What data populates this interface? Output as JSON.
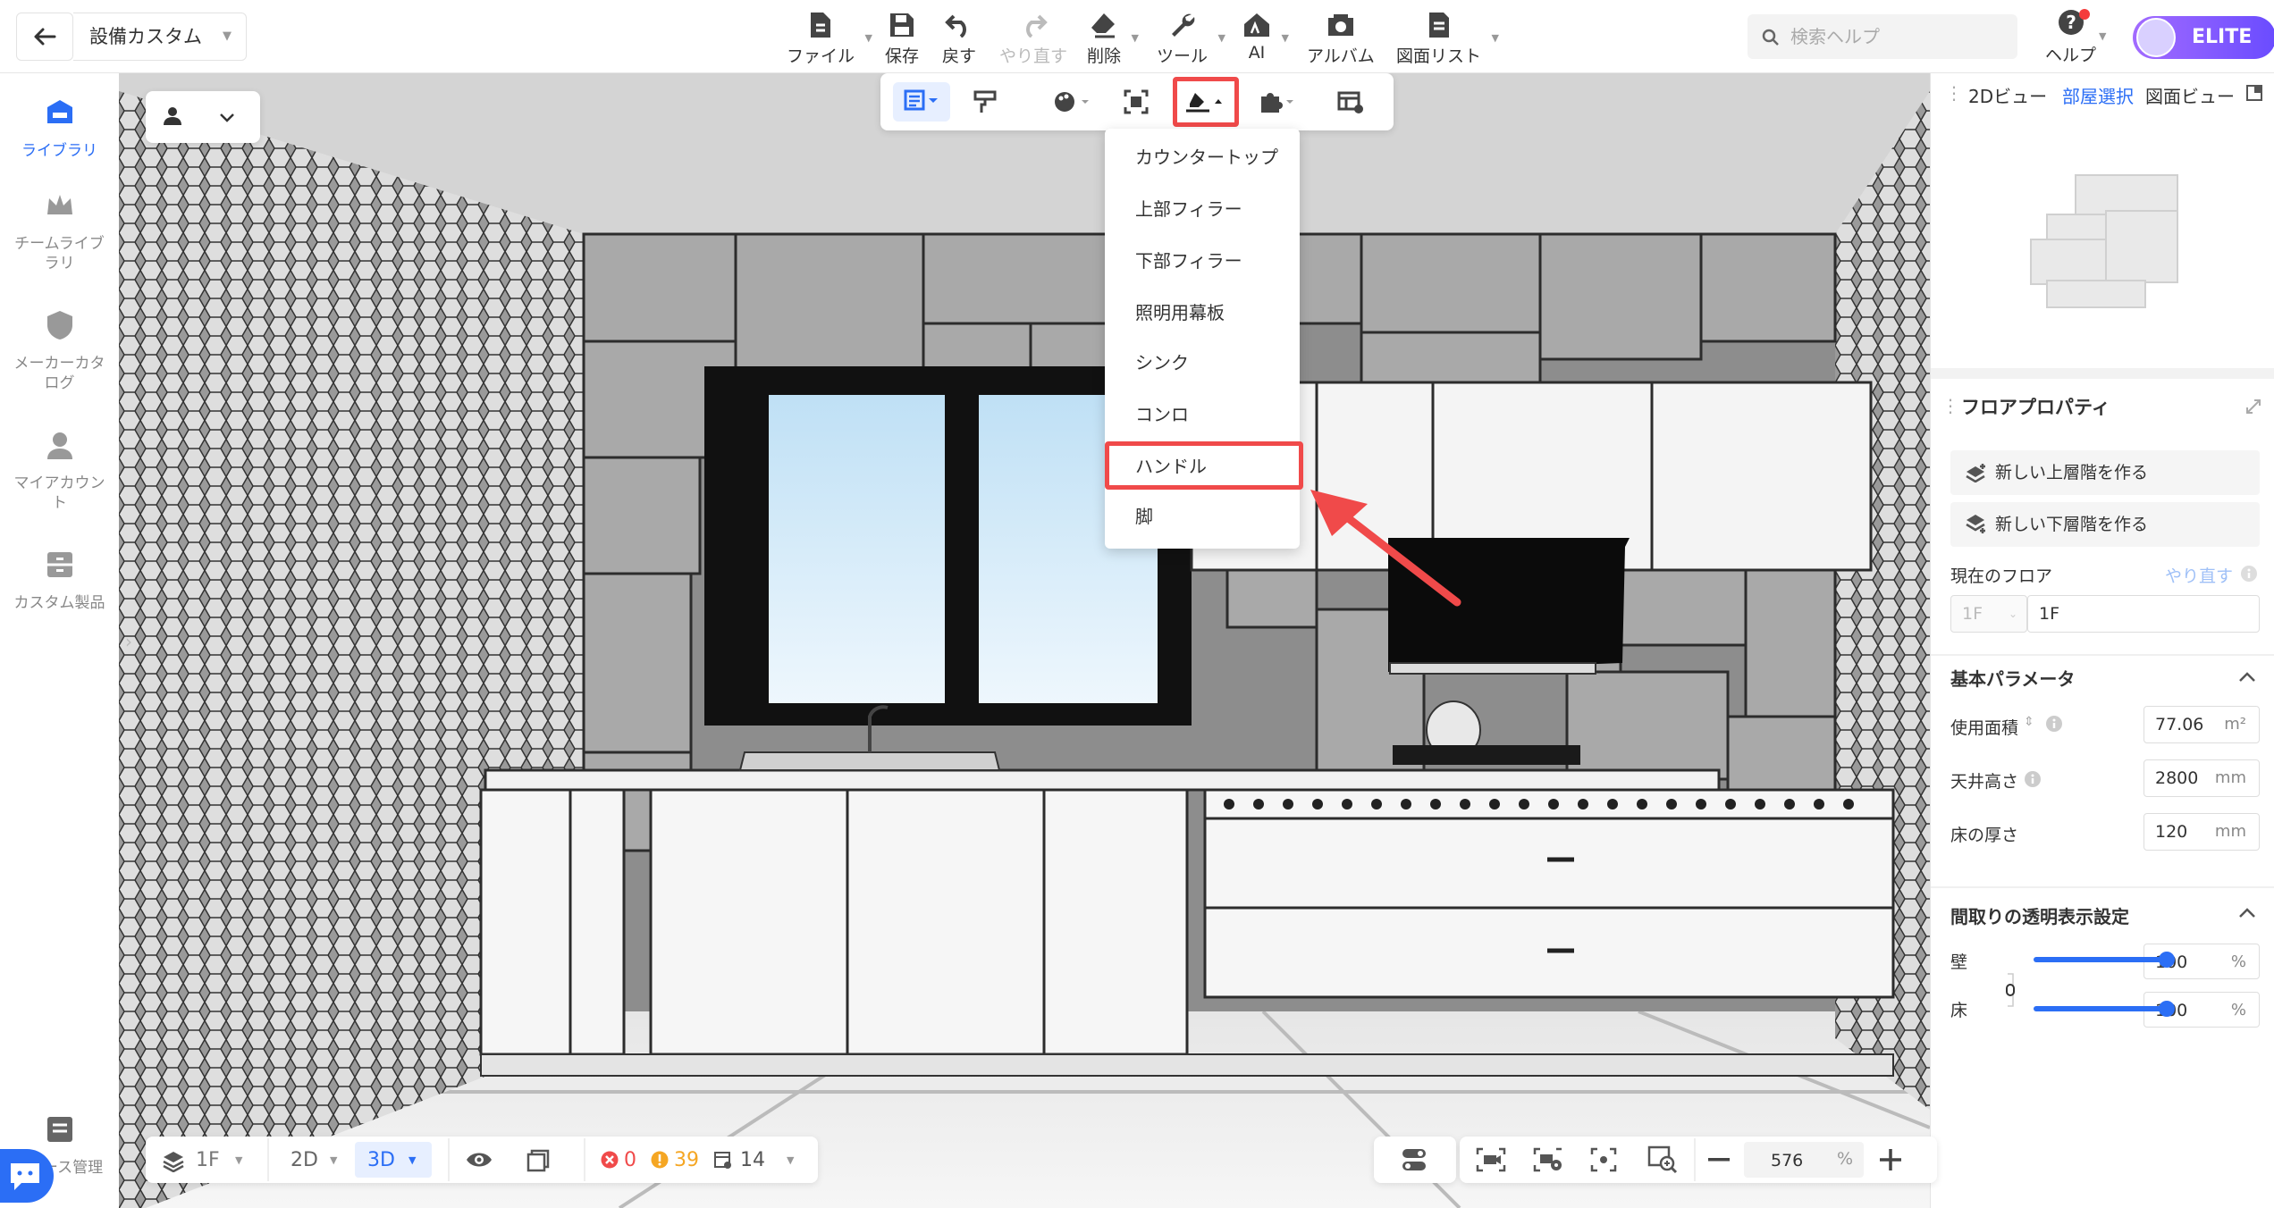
{
  "header": {
    "title": "設備カスタム",
    "toolbar": [
      {
        "label": "ファイル",
        "icon": "file-icon"
      },
      {
        "label": "保存",
        "icon": "save-icon"
      },
      {
        "label": "戻す",
        "icon": "undo-icon"
      },
      {
        "label": "やり直す",
        "icon": "redo-icon"
      },
      {
        "label": "削除",
        "icon": "eraser-icon"
      },
      {
        "label": "ツール",
        "icon": "wrench-icon"
      },
      {
        "label": "AI",
        "icon": "ai-house-icon"
      },
      {
        "label": "アルバム",
        "icon": "album-icon"
      },
      {
        "label": "図面リスト",
        "icon": "drawing-list-icon"
      }
    ],
    "search_placeholder": "検索ヘルプ",
    "help_label": "ヘルプ",
    "elite_label": "ELITE"
  },
  "sidebar": {
    "items": [
      {
        "label": "ライブラリ",
        "active": true
      },
      {
        "label": "チームライブラリ"
      },
      {
        "label": "メーカーカタログ"
      },
      {
        "label": "マイアカウント"
      },
      {
        "label": "カスタム製品"
      },
      {
        "label": "ース管理"
      }
    ]
  },
  "context_menu": {
    "items": [
      "カウンタートップ",
      "上部フィラー",
      "下部フィラー",
      "照明用幕板",
      "シンク",
      "コンロ",
      "ハンドル",
      "脚"
    ],
    "highlighted": "ハンドル"
  },
  "right_panel": {
    "tabs": [
      "2Dビュー",
      "部屋選択",
      "図面ビュー"
    ],
    "active_tab": "部屋選択",
    "floor_props_title": "フロアプロパティ",
    "new_upper_floor": "新しい上層階を作る",
    "new_lower_floor": "新しい下層階を作る",
    "current_floor_label": "現在のフロア",
    "redo_label": "やり直す",
    "floor_select": "1F",
    "floor_name": "1F",
    "basic_params_title": "基本パラメータ",
    "area_label": "使用面積",
    "area_value": "77.06",
    "area_unit": "m²",
    "ceiling_label": "天井高さ",
    "ceiling_value": "2800",
    "ceiling_unit": "mm",
    "floor_thickness_label": "床の厚さ",
    "floor_thickness_value": "120",
    "floor_thickness_unit": "mm",
    "transparency_title": "間取りの透明表示設定",
    "wall_label": "壁",
    "wall_value": "100",
    "floor_label": "床",
    "floor_value": "100",
    "percent": "%"
  },
  "bottom_bar": {
    "floor": "1F",
    "view_2d": "2D",
    "view_3d": "3D",
    "errors": "0",
    "warnings": "39",
    "items": "14",
    "zoom": "576",
    "zoom_unit": "%"
  },
  "colors": {
    "accent": "#2b6ef5",
    "highlight_red": "#f04a4a",
    "elite_start": "#a26bff",
    "elite_end": "#6a4cff"
  }
}
